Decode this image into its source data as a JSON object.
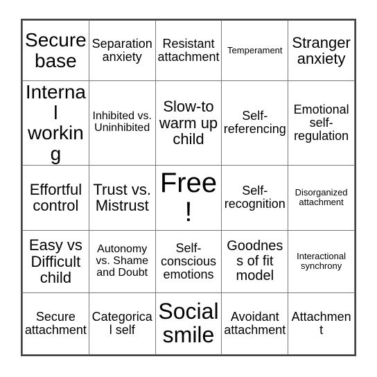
{
  "card": {
    "title": "Bingo Card",
    "rows": 5,
    "columns": 5,
    "free_space": {
      "row": 2,
      "column": 2,
      "label": "Free!"
    },
    "colors": {
      "background": "#ffffff",
      "text": "#000000",
      "outer_border": "#444444",
      "inner_border": "#777777"
    },
    "cells": [
      [
        {
          "label": "Secure base",
          "size": "fs-xl"
        },
        {
          "label": "Separation anxiety",
          "size": "fs-sm"
        },
        {
          "label": "Resistant attachment",
          "size": "fs-sm"
        },
        {
          "label": "Temperament",
          "size": "fs-xs"
        },
        {
          "label": "Stranger anxiety",
          "size": "fs-ml"
        }
      ],
      [
        {
          "label": "Internal working",
          "size": "fs-xl"
        },
        {
          "label": "Inhibited vs. Uninhibited",
          "size": "fs-s"
        },
        {
          "label": "Slow-to warm up child",
          "size": "fs-ml"
        },
        {
          "label": "Self-referencing",
          "size": "fs-sm"
        },
        {
          "label": "Emotional self-regulation",
          "size": "fs-sm"
        }
      ],
      [
        {
          "label": "Effortful control",
          "size": "fs-ml"
        },
        {
          "label": "Trust vs. Mistrust",
          "size": "fs-ml"
        },
        {
          "label": "Free!",
          "size": "fs-free"
        },
        {
          "label": "Self-recognition",
          "size": "fs-sm"
        },
        {
          "label": "Disorganized attachment",
          "size": "fs-xs"
        }
      ],
      [
        {
          "label": "Easy vs Difficult child",
          "size": "fs-ml"
        },
        {
          "label": "Autonomy vs. Shame and Doubt",
          "size": "fs-s"
        },
        {
          "label": "Self-conscious emotions",
          "size": "fs-sm"
        },
        {
          "label": "Goodness of fit model",
          "size": "fs-m"
        },
        {
          "label": "Interactional synchrony",
          "size": "fs-xs"
        }
      ],
      [
        {
          "label": "Secure attachment",
          "size": "fs-sm"
        },
        {
          "label": "Categorical self",
          "size": "fs-sm"
        },
        {
          "label": "Social smile",
          "size": "fs-xxl"
        },
        {
          "label": "Avoidant attachment",
          "size": "fs-sm"
        },
        {
          "label": "Attachment",
          "size": "fs-sm"
        }
      ]
    ]
  }
}
